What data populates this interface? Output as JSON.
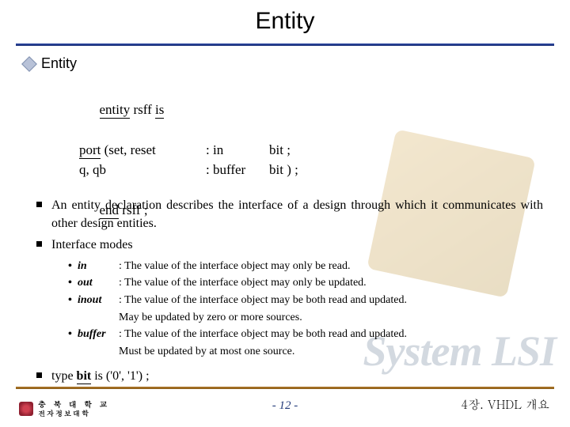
{
  "title": "Entity",
  "section_title": "Entity",
  "code": {
    "l1_kw": "entity",
    "l1_rest": " rsff ",
    "l1_kw2": "is",
    "l2_indent": "          ",
    "l2_kw": "port",
    "l2_rest": " (set, reset",
    "l3_indent": "                    q, qb",
    "l4_kw": "end",
    "l4_rest": " rsff ;",
    "c1a": ": in",
    "c1b": "bit  ;",
    "c2a": ": buffer",
    "c2b": "bit ) ;"
  },
  "bullets": {
    "b1": "An entity declaration describes the interface of a design through which it communicates with other design entities.",
    "b2": "Interface modes",
    "modes": [
      {
        "name": "in",
        "desc": ": The value of the interface object may only be read."
      },
      {
        "name": "out",
        "desc": ": The value of the interface object may only be updated."
      },
      {
        "name": "inout",
        "desc": ": The value of the interface object may be both read and updated.",
        "cont": "  May be updated by zero or more sources."
      },
      {
        "name": "buffer",
        "desc": ": The value of the interface object may be both read and updated.",
        "cont": "  Must be updated by at most one source."
      }
    ],
    "b3_pre": "type ",
    "b3_u": "bit",
    "b3_post": " is ('0', '1') ;"
  },
  "watermark_a": "System ",
  "watermark_b": "LSI",
  "footer": {
    "logo_line1": "충 북 대 학 교",
    "logo_line2": "전자정보대학",
    "page": "-  12  -",
    "chapter": "4장. VHDL 개요"
  }
}
